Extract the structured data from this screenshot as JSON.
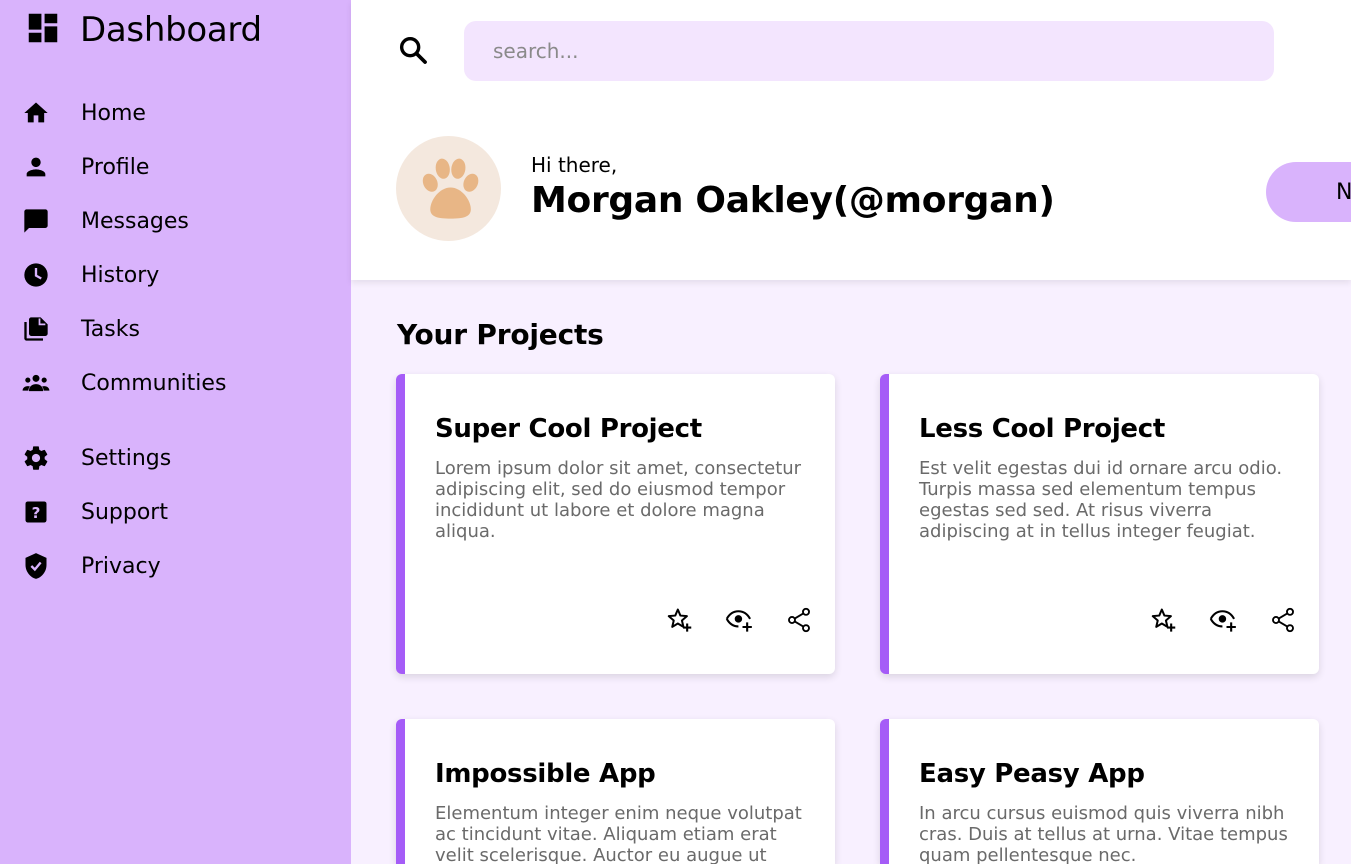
{
  "brand": {
    "title": "Dashboard",
    "icon": "dashboard-icon"
  },
  "sidebar": {
    "items": [
      {
        "label": "Home",
        "icon": "home-icon"
      },
      {
        "label": "Profile",
        "icon": "person-icon"
      },
      {
        "label": "Messages",
        "icon": "chat-icon"
      },
      {
        "label": "History",
        "icon": "clock-icon"
      },
      {
        "label": "Tasks",
        "icon": "documents-icon"
      },
      {
        "label": "Communities",
        "icon": "group-icon"
      },
      {
        "label": "Settings",
        "icon": "gear-icon"
      },
      {
        "label": "Support",
        "icon": "help-icon"
      },
      {
        "label": "Privacy",
        "icon": "shield-icon"
      }
    ]
  },
  "header": {
    "search": {
      "placeholder": "search..."
    },
    "greeting": "Hi there,",
    "username": "Morgan Oakley(@morgan)",
    "new_button": "New"
  },
  "projects": {
    "title": "Your Projects",
    "cards": [
      {
        "title": "Super Cool Project",
        "description": "Lorem ipsum dolor sit amet, consectetur adipiscing elit, sed do eiusmod tempor incididunt ut labore et dolore magna aliqua."
      },
      {
        "title": "Less Cool Project",
        "description": "Est velit egestas dui id ornare arcu odio. Turpis massa sed elementum tempus egestas sed sed. At risus viverra adipiscing at in tellus integer feugiat."
      },
      {
        "title": "Impossible App",
        "description": "Elementum integer enim neque volutpat ac tincidunt vitae. Aliquam etiam erat velit scelerisque. Auctor eu augue ut"
      },
      {
        "title": "Easy Peasy App",
        "description": "In arcu cursus euismod quis viverra nibh cras. Duis at tellus at urna. Vitae tempus quam pellentesque nec."
      }
    ]
  },
  "colors": {
    "sidebar": "#d9b3fc",
    "accent": "#a55cf7",
    "search_bg": "#f3e5fe",
    "content_bg": "#f8f0ff"
  }
}
